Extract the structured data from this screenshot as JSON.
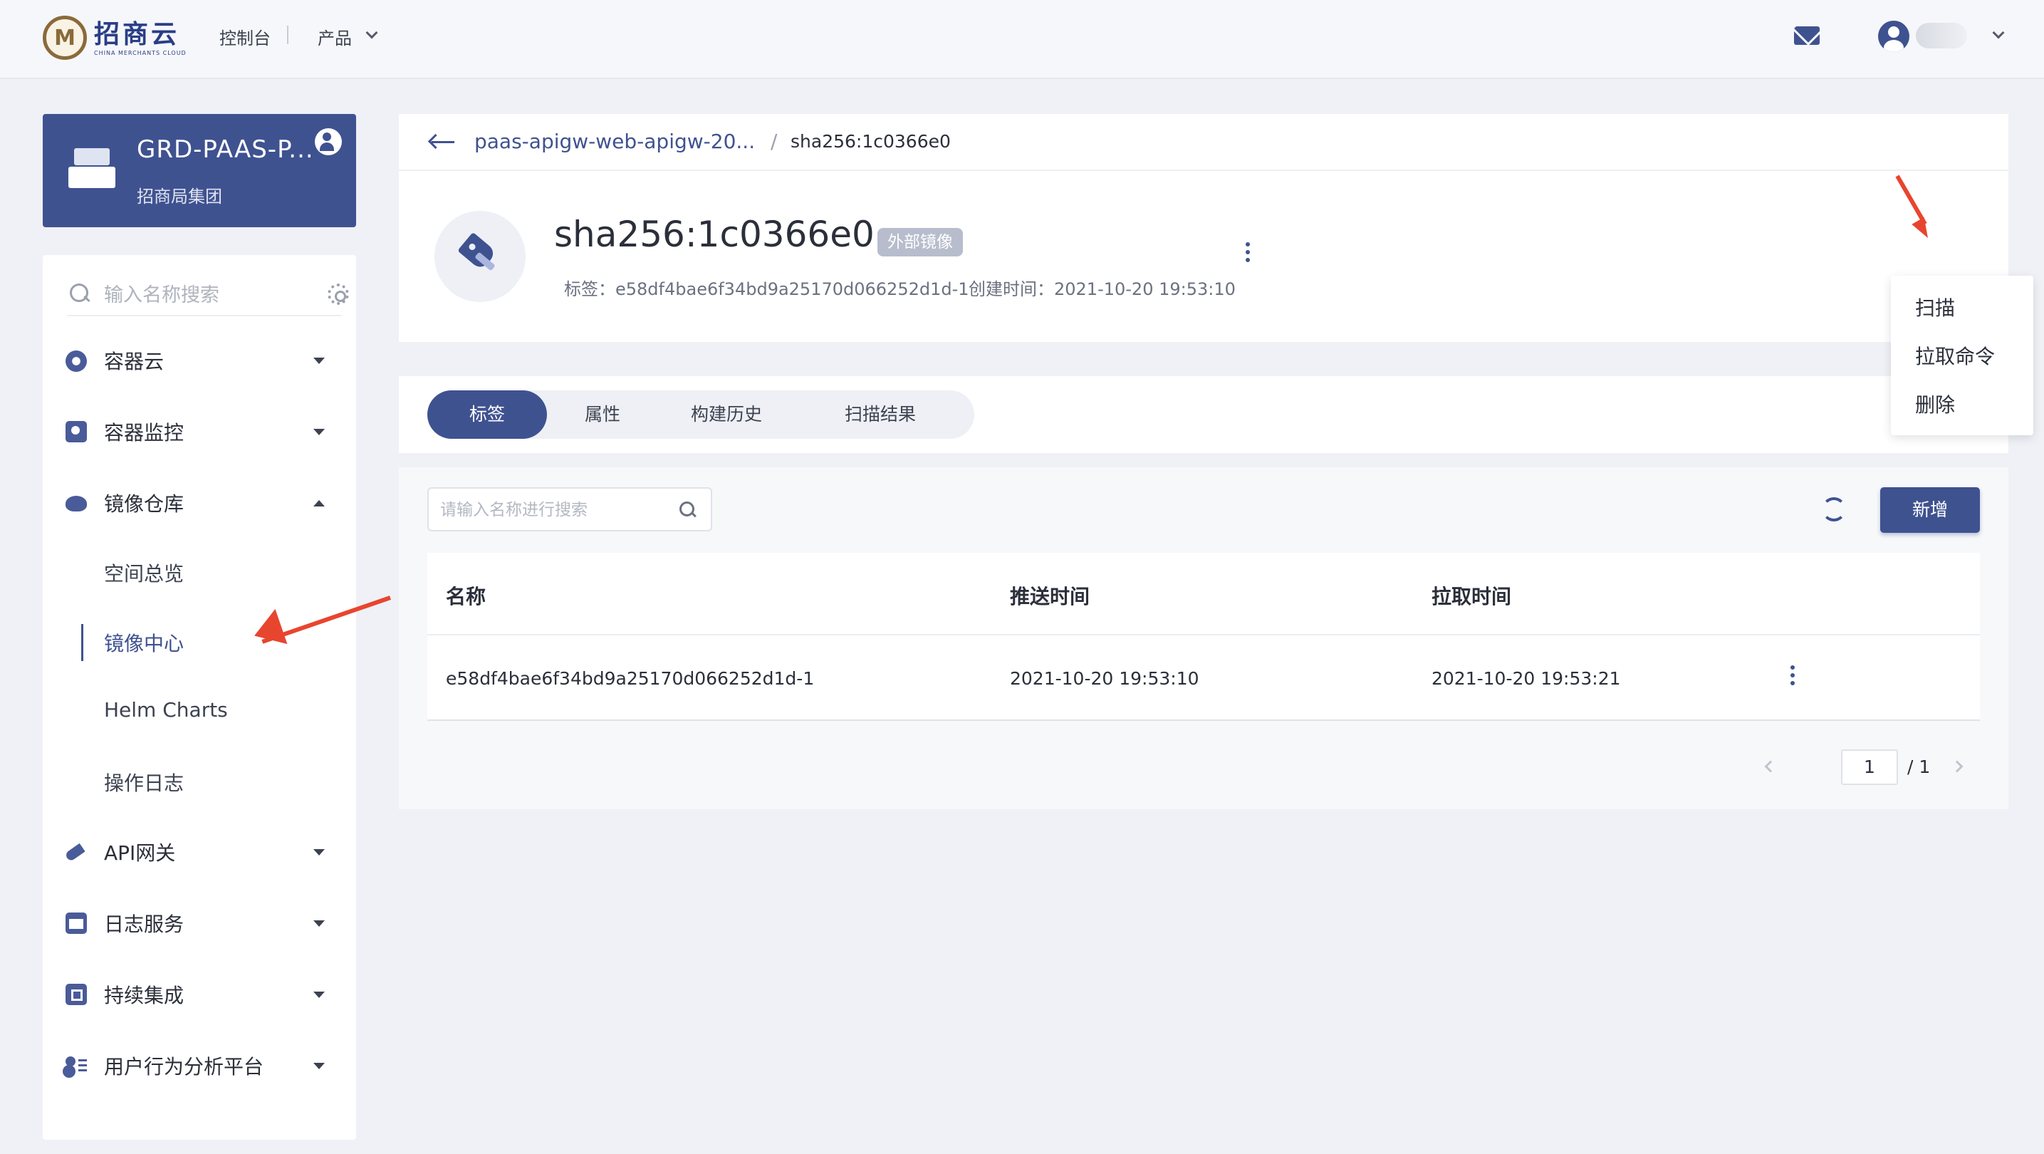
{
  "topbar": {
    "logo_cn": "招商云",
    "logo_en": "CHINA MERCHANTS CLOUD",
    "console": "控制台",
    "product": "产品"
  },
  "project": {
    "name": "GRD-PAAS-P...",
    "group": "招商局集团"
  },
  "sidebar": {
    "search_placeholder": "输入名称搜索",
    "items": [
      {
        "label": "容器云",
        "icon": "hexagon-icon"
      },
      {
        "label": "容器监控",
        "icon": "monitor-icon"
      },
      {
        "label": "镜像仓库",
        "icon": "whale-icon"
      },
      {
        "label": "API网关",
        "icon": "rocket-icon"
      },
      {
        "label": "日志服务",
        "icon": "calendar-icon"
      },
      {
        "label": "持续集成",
        "icon": "ci-icon"
      },
      {
        "label": "用户行为分析平台",
        "icon": "users-icon"
      }
    ],
    "sub_items": [
      "空间总览",
      "镜像中心",
      "Helm Charts",
      "操作日志"
    ]
  },
  "breadcrumb": {
    "parent": "paas-apigw-web-apigw-20...",
    "separator": "/",
    "current": "sha256:1c0366e0"
  },
  "image": {
    "title": "sha256:1c0366e0",
    "badge": "外部镜像",
    "tag_line": "标签：e58df4bae6f34bd9a25170d066252d1d-1",
    "created_line": "创建时间：2021-10-20 19:53:10"
  },
  "tabs": [
    "标签",
    "属性",
    "构建历史",
    "扫描结果"
  ],
  "table": {
    "search_placeholder": "请输入名称进行搜索",
    "new_button": "新增",
    "headers": [
      "名称",
      "推送时间",
      "拉取时间"
    ],
    "rows": [
      {
        "name": "e58df4bae6f34bd9a25170d066252d1d-1",
        "push_time": "2021-10-20 19:53:10",
        "pull_time": "2021-10-20 19:53:21"
      }
    ]
  },
  "pagination": {
    "current": "1",
    "total": "/ 1"
  },
  "dropdown": {
    "items": [
      "扫描",
      "拉取命令",
      "删除"
    ]
  },
  "colors": {
    "primary": "#3f5290",
    "annotation": "#e8452f",
    "background": "#eff1f6"
  }
}
